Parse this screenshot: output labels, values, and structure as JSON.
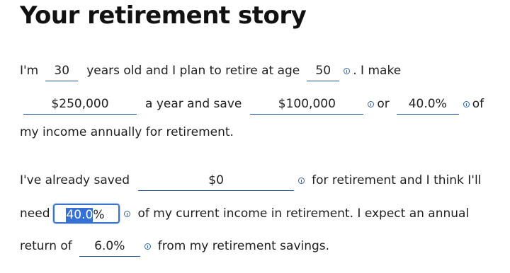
{
  "title": "Your retirement story",
  "para1": {
    "im": "I'm",
    "age_value": "30",
    "t_years": "years old and I plan to retire at age",
    "retire_age_value": "50",
    "t_make": ". I make",
    "income_value": "$250,000",
    "t_year_save": "a year and save",
    "savings_value": "$100,000",
    "t_or": "or",
    "savings_pct_value": "40.0%",
    "t_of": "of",
    "t_income_annually": "my income annually for retirement."
  },
  "para2": {
    "t_already": "I've already saved",
    "saved_value": "$0",
    "t_for_ret": "for retirement and I think I'll",
    "t_need": "need",
    "need_pct_selected": "40.0",
    "need_pct_rest": "%",
    "t_current": "of my current income in retirement. I expect an annual",
    "t_return_of": "return of",
    "return_value": "6.0%",
    "t_from": "from my retirement savings."
  },
  "colors": {
    "accent": "#1c4e9b",
    "selection": "#3470d6",
    "focus_border": "#3d73c9"
  },
  "icons": {
    "info": "info-circle-icon"
  }
}
